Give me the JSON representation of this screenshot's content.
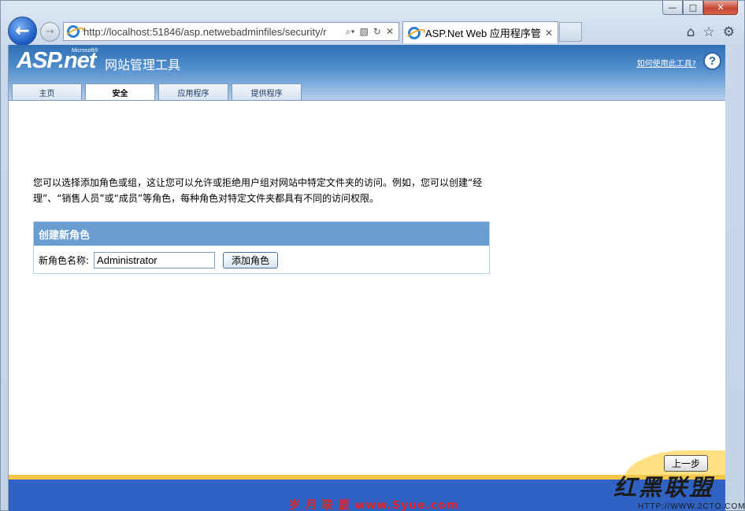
{
  "browser": {
    "address": "http://localhost:51846/asp.netwebadminfiles/security/r",
    "tab_title": "ASP.Net Web 应用程序管理",
    "caption": {
      "minimize": "—",
      "maximize": "□",
      "close": "✕"
    }
  },
  "site": {
    "logo_text": "ASP.net",
    "logo_small": "Microsoft®",
    "tool_title": "网站管理工具",
    "help_link": "如何使用此工具?",
    "help_icon_glyph": "?",
    "tabs": [
      {
        "label": "主页",
        "active": false
      },
      {
        "label": "安全",
        "active": true
      },
      {
        "label": "应用程序",
        "active": false
      },
      {
        "label": "提供程序",
        "active": false
      }
    ]
  },
  "main": {
    "description": "您可以选择添加角色或组，这让您可以允许或拒绝用户组对网站中特定文件夹的访问。例如，您可以创建“经理”、“销售人员”或“成员”等角色，每种角色对特定文件夹都具有不同的访问权限。",
    "panel_title": "创建新角色",
    "field_label": "新角色名称:",
    "field_value": "Administrator",
    "add_button": "添加角色",
    "prev_button": "上一步"
  },
  "watermarks": {
    "bottom_center": "岁 月 联 盟  www.Syue.com",
    "bottom_right_title": "红黑联盟",
    "bottom_right_url": "HTTP://WWW.2CTO.COM"
  },
  "colors": {
    "banner": "#4f8ccc",
    "panel_header": "#6a9dd2",
    "footer": "#2f62c2",
    "footer_band": "#f3c64a"
  }
}
